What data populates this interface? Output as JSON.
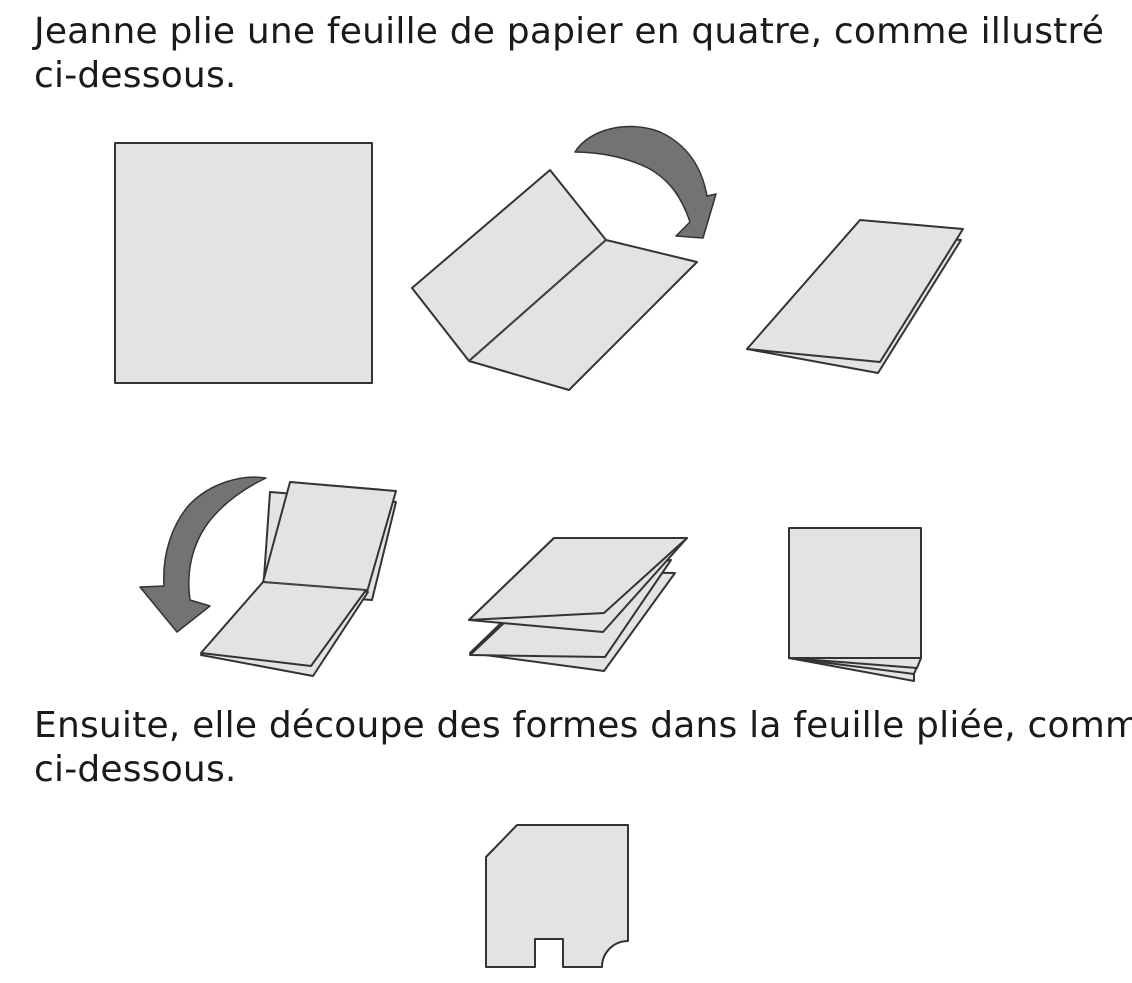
{
  "text": {
    "intro_line1": "Jeanne plie une feuille de papier en quatre, comme illustré",
    "intro_line2": "ci-dessous.",
    "cut_line1": "Ensuite, elle découpe des formes dans la feuille pliée, comme",
    "cut_line2": "ci-dessous."
  },
  "figures": {
    "folding_steps": [
      "flat-square-sheet",
      "first-fold-opening",
      "folded-in-half",
      "second-fold-opening",
      "folded-in-quarters-side",
      "folded-in-quarters-square"
    ],
    "arrow_icons": [
      "curved-arrow-clockwise",
      "curved-arrow-counterclockwise"
    ],
    "cut_shape": "folded-square-with-cutouts"
  },
  "colors": {
    "paper_fill": "#e3e3e4",
    "outline": "#333333",
    "arrow_fill": "#737373"
  }
}
